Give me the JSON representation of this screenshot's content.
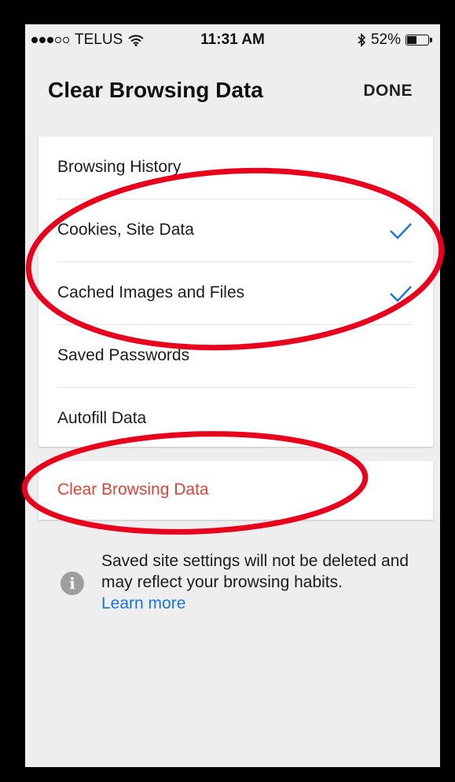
{
  "status_bar": {
    "carrier": "TELUS",
    "time": "11:31 AM",
    "battery_percent": "52%",
    "battery_level": 0.52,
    "signal_bars_filled": 3,
    "signal_bars_total": 5
  },
  "header": {
    "title": "Clear Browsing Data",
    "done_label": "DONE"
  },
  "options": [
    {
      "label": "Browsing History",
      "checked": false
    },
    {
      "label": "Cookies, Site Data",
      "checked": true
    },
    {
      "label": "Cached Images and Files",
      "checked": true
    },
    {
      "label": "Saved Passwords",
      "checked": false
    },
    {
      "label": "Autofill Data",
      "checked": false
    }
  ],
  "clear_button": {
    "label": "Clear Browsing Data"
  },
  "info": {
    "text": "Saved site settings will not be deleted and may reflect your browsing habits.",
    "link_text": "Learn more"
  },
  "colors": {
    "check": "#1a73e8",
    "destructive": "#db4437",
    "link": "#1a73e8",
    "annotation": "#e8001c",
    "background": "#eeeeee"
  },
  "icons": {
    "check": "checkmark-icon",
    "info": "info-icon",
    "wifi": "wifi-icon",
    "bluetooth": "bluetooth-icon",
    "battery": "battery-icon"
  }
}
